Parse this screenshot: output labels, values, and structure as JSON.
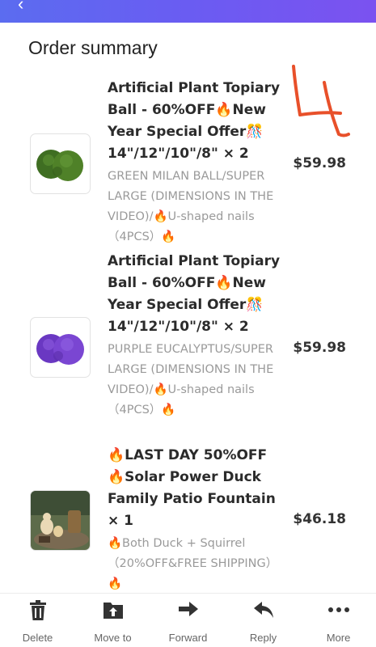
{
  "header": {
    "back_icon": "arrow-back-icon"
  },
  "section_title": "Order summary",
  "handwritten_mark": "4",
  "items": [
    {
      "name": "Artificial Plant Topiary Ball - 60%OFF🔥New Year Special Offer🎊 14\"/12\"/10\"/8\" × 2",
      "variant": "GREEN MILAN BALL/SUPER LARGE (DIMENSIONS IN THE VIDEO)/🔥U-shaped nails（4PCS）🔥",
      "price": "$59.98",
      "image": "green-topiary-balls"
    },
    {
      "name": "Artificial Plant Topiary Ball - 60%OFF🔥New Year Special Offer🎊 14\"/12\"/10\"/8\" × 2",
      "variant": "PURPLE EUCALYPTUS/SUPER LARGE (DIMENSIONS IN THE VIDEO)/🔥U-shaped nails（4PCS）🔥",
      "price": "$59.98",
      "image": "purple-topiary-balls"
    },
    {
      "name": "🔥LAST DAY 50%OFF🔥Solar Power Duck Family Patio Fountain × 1",
      "variant": "🔥Both Duck + Squirrel （20%OFF&FREE SHIPPING）🔥",
      "price": "$46.18",
      "image": "duck-fountain"
    }
  ],
  "toolbar": {
    "delete": "Delete",
    "move_to": "Move to",
    "forward": "Forward",
    "reply": "Reply",
    "more": "More"
  },
  "colors": {
    "accent_start": "#5b6cf0",
    "accent_end": "#7b52f0",
    "annotation": "#e8502a"
  }
}
